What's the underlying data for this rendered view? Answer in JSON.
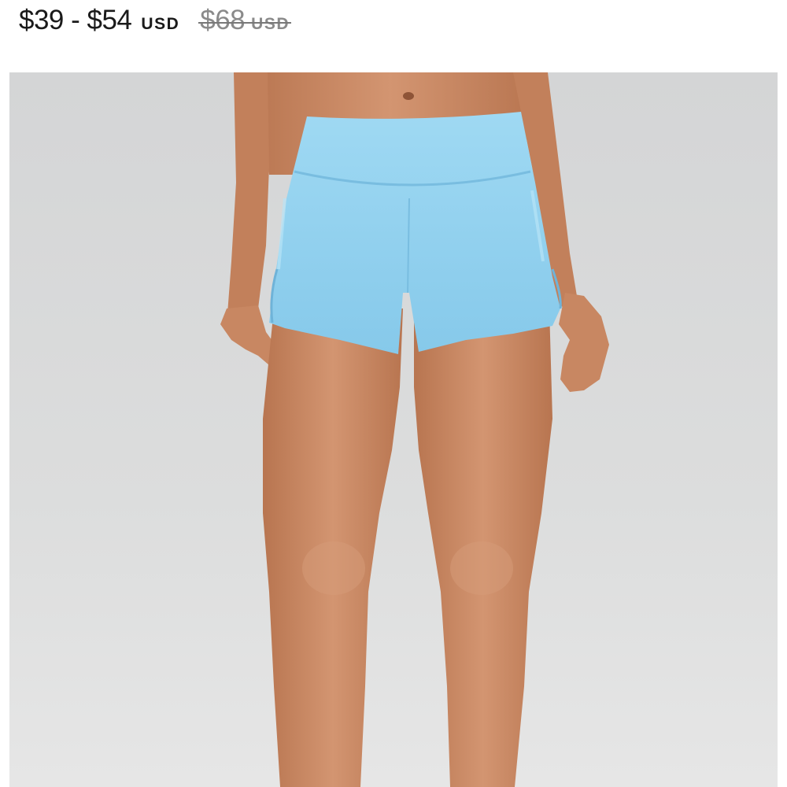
{
  "price": {
    "range": "$39 - $54",
    "currency": "USD",
    "compare_at": "$68",
    "compare_currency": "USD"
  },
  "product_image": {
    "alt": "",
    "colors": {
      "background": "#d9dadb",
      "shorts": "#8fd0ee",
      "skin": "#c98a63"
    }
  }
}
